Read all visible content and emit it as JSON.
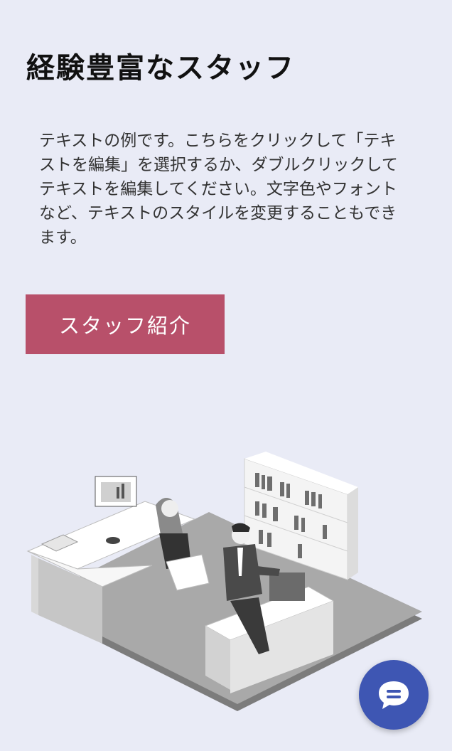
{
  "section": {
    "title": "経験豊富なスタッフ",
    "paragraph": "テキストの例です。こちらをクリックして「テキストを編集」を選択するか、ダブルクリックしてテキストを編集してください。文字色やフォントなど、テキストのスタイルを変更することもできます。",
    "button_label": "スタッフ紹介"
  },
  "colors": {
    "background": "#e9ebf6",
    "button": "#b8506a",
    "chat": "#3e56b3"
  },
  "icons": {
    "chat": "chat-bubble-icon",
    "illustration": "office-illustration"
  }
}
